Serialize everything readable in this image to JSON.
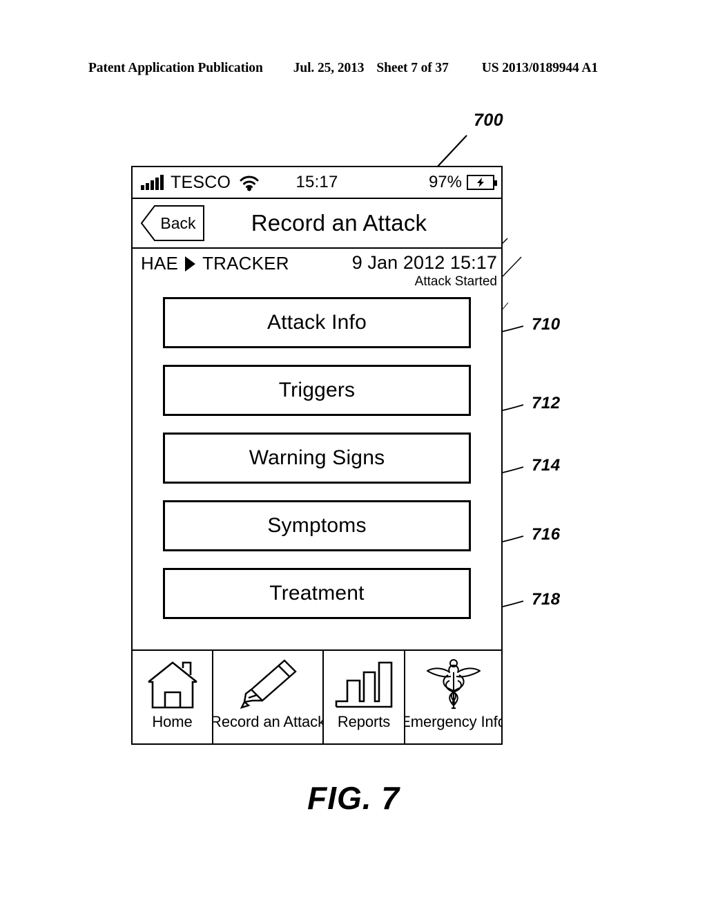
{
  "patent_header": {
    "publication": "Patent Application Publication",
    "date": "Jul. 25, 2013",
    "sheet": "Sheet 7 of 37",
    "number": "US 2013/0189944 A1"
  },
  "figure": {
    "caption": "FIG. 7",
    "device_ref": "700"
  },
  "status_bar": {
    "signal_icon": "signal-bars-icon",
    "carrier": "TESCO",
    "wifi_icon": "wifi-icon",
    "time": "15:17",
    "battery_percent": "97%",
    "battery_icon": "battery-charging-icon"
  },
  "nav_bar": {
    "back_label": "Back",
    "title": "Record an Attack"
  },
  "breadcrumb": {
    "app_name": "HAE",
    "arrow_icon": "triangle-right-icon",
    "section": "TRACKER"
  },
  "attack": {
    "timestamp": "9 Jan 2012 15:17",
    "started_label": "Attack Started"
  },
  "menu": {
    "items": [
      {
        "label": "Attack Info",
        "ref": "710"
      },
      {
        "label": "Triggers",
        "ref": "712"
      },
      {
        "label": "Warning Signs",
        "ref": "714"
      },
      {
        "label": "Symptoms",
        "ref": "716"
      },
      {
        "label": "Treatment",
        "ref": "718"
      }
    ]
  },
  "tab_bar": {
    "items": [
      {
        "label": "Home",
        "icon": "house-icon"
      },
      {
        "label": "Record an Attack",
        "icon": "pencil-icon"
      },
      {
        "label": "Reports",
        "icon": "bar-chart-icon"
      },
      {
        "label": "Emergency Info",
        "icon": "caduceus-icon"
      }
    ]
  },
  "colors": {
    "ink": "#000000",
    "paper": "#ffffff"
  }
}
